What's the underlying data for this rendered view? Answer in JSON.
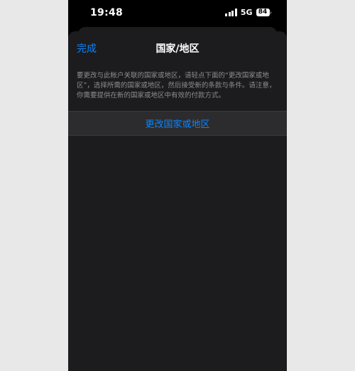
{
  "status_bar": {
    "time": "19:48",
    "network": "5G",
    "battery_percent": "84"
  },
  "nav": {
    "done_label": "完成",
    "title": "国家/地区"
  },
  "description": "要更改与此帐户关联的国家或地区，请轻点下面的“更改国家或地区”，选择所需的国家或地区，然后接受新的条款与条件。请注意，你需要提供在新的国家或地区中有效的付款方式。",
  "change_button_label": "更改国家或地区",
  "colors": {
    "accent": "#0a84ff",
    "sheet_background": "#1c1c1e",
    "row_background": "#2c2c2e",
    "secondary_text": "#8e8e93"
  }
}
